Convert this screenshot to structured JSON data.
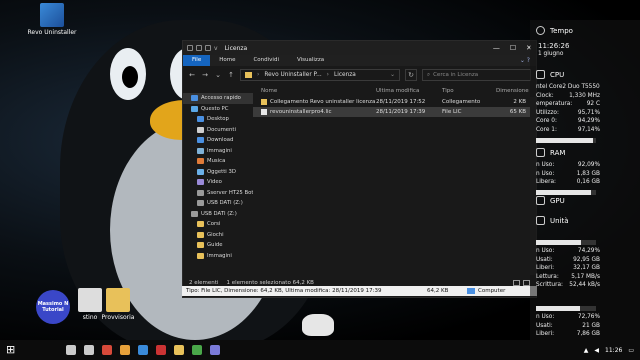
{
  "desktop": {
    "icons": [
      {
        "label": "Revo Uninstaller",
        "icon": "revo-uninstaller-icon"
      },
      {
        "label": "stino",
        "icon": "file-icon"
      },
      {
        "label": "Provvisoria",
        "icon": "folder-icon"
      }
    ],
    "badge": {
      "line1": "Massimo N",
      "line2": "Tutorial"
    }
  },
  "explorer": {
    "title": "Licenza",
    "title_prefix": "v",
    "ribbon_tabs": [
      "File",
      "Home",
      "Condividi",
      "Visualizza"
    ],
    "address": {
      "crumbs": [
        "Revo Uninstaller P...",
        "Licenza"
      ]
    },
    "search_placeholder": "Cerca in Licenza",
    "nav": [
      {
        "label": "Accesso rapido",
        "icon": "star-icon",
        "color": "#4a90e2"
      },
      {
        "label": "Questo PC",
        "icon": "computer-icon",
        "color": "#5aa7e6"
      },
      {
        "label": "Desktop",
        "icon": "desktop-icon",
        "color": "#4a90e2"
      },
      {
        "label": "Documenti",
        "icon": "documents-icon",
        "color": "#cfcfcf"
      },
      {
        "label": "Download",
        "icon": "download-icon",
        "color": "#4a90e2"
      },
      {
        "label": "Immagini",
        "icon": "pictures-icon",
        "color": "#7fb2d8"
      },
      {
        "label": "Musica",
        "icon": "music-icon",
        "color": "#e07b39"
      },
      {
        "label": "Oggetti 3D",
        "icon": "objects-3d-icon",
        "color": "#6ab0e8"
      },
      {
        "label": "Video",
        "icon": "video-icon",
        "color": "#9a8ad8"
      },
      {
        "label": "Sserver HT25 Bot",
        "icon": "drive-icon",
        "color": "#9a9a9a"
      },
      {
        "label": "USB DATI (Z:)",
        "icon": "usb-drive-icon",
        "color": "#9a9a9a"
      },
      {
        "label": "USB DATI (Z:)",
        "icon": "usb-drive-icon",
        "color": "#9a9a9a"
      },
      {
        "label": "Corsi",
        "icon": "folder-icon",
        "color": "#e8c15a"
      },
      {
        "label": "Giochi",
        "icon": "folder-icon",
        "color": "#e8c15a"
      },
      {
        "label": "Guide",
        "icon": "folder-icon",
        "color": "#e8c15a"
      },
      {
        "label": "Immagini",
        "icon": "folder-icon",
        "color": "#e8c15a"
      }
    ],
    "columns": {
      "name": "Nome",
      "date": "Ultima modifica",
      "type": "Tipo",
      "size": "Dimensione"
    },
    "files": [
      {
        "name": "Collegamento Revo uninstaller licenza",
        "date": "28/11/2019 17:52",
        "type": "Collegamento",
        "size": "2 KB",
        "icon": "shortcut-icon",
        "selected": false
      },
      {
        "name": "revouninstallerpro4.lic",
        "date": "28/11/2019 17:39",
        "type": "File LIC",
        "size": "65 KB",
        "icon": "file-icon",
        "selected": true
      }
    ],
    "status": {
      "count": "2 elementi",
      "selected": "1 elemento selezionato 64,2 KB"
    },
    "infobar": {
      "text": "Tipo: File LIC, Dimensione: 64,2 KB, Ultima modifica: 28/11/2019 17:39",
      "size": "64,2 KB",
      "location": "Computer"
    }
  },
  "gadget": {
    "time_title": "Tempo",
    "time": "11:26:26",
    "date": "1 giugno",
    "cpu_title": "CPU",
    "cpu_rows": [
      {
        "label": "ntel Core2 Duo T5550",
        "value": ""
      },
      {
        "label": "Clock:",
        "value": "1,330 MHz"
      },
      {
        "label": "emperatura:",
        "value": "92 C"
      },
      {
        "label": "Utilizzo:",
        "value": "95,71%"
      },
      {
        "label": "Core 0:",
        "value": "94,29%"
      },
      {
        "label": "Core 1:",
        "value": "97,14%"
      }
    ],
    "cpu_usage": 0.957,
    "ram_title": "RAM",
    "ram_rows": [
      {
        "label": "n Uso:",
        "value": "92,09%"
      },
      {
        "label": "n Uso:",
        "value": "1,83 GB"
      },
      {
        "label": "Libera:",
        "value": "0,16 GB"
      }
    ],
    "ram_usage": 0.921,
    "gpu_title": "GPU",
    "disk_title": "Unità",
    "disk1_rows": [
      {
        "label": "n Uso:",
        "value": "74,29%"
      },
      {
        "label": "Usati:",
        "value": "92,95 GB"
      },
      {
        "label": "Liberi:",
        "value": "32,17 GB"
      },
      {
        "label": "Lettura:",
        "value": "5,17 MB/s"
      },
      {
        "label": "Scrittura:",
        "value": "52,44 kB/s"
      }
    ],
    "disk1_usage": 0.743,
    "disk2_rows": [
      {
        "label": "n Uso:",
        "value": "72,76%"
      },
      {
        "label": "Usati:",
        "value": "21 GB"
      },
      {
        "label": "Liberi:",
        "value": "7,86 GB"
      }
    ],
    "disk2_usage": 0.728
  },
  "taskbar": {
    "clock": "11:26",
    "apps": [
      {
        "icon": "search-icon",
        "color": "#cccccc"
      },
      {
        "icon": "task-view-icon",
        "color": "#cccccc"
      },
      {
        "icon": "app-icon-1",
        "color": "#d84a3a"
      },
      {
        "icon": "app-icon-2",
        "color": "#e8a13a"
      },
      {
        "icon": "app-icon-3",
        "color": "#3a8ad8"
      },
      {
        "icon": "app-icon-4",
        "color": "#cc3333"
      },
      {
        "icon": "file-explorer-icon",
        "color": "#e8c15a"
      },
      {
        "icon": "app-icon-5",
        "color": "#4aa84a"
      },
      {
        "icon": "app-icon-6",
        "color": "#7a7ad8"
      }
    ]
  }
}
